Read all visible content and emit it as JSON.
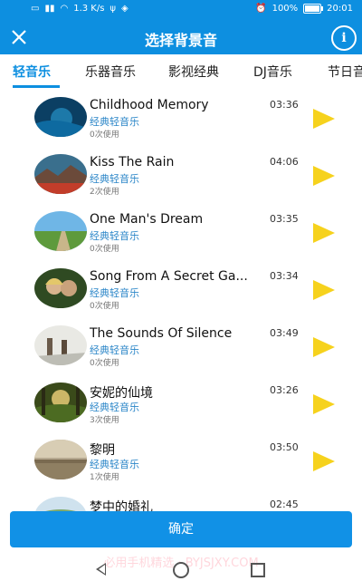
{
  "status_bar": {
    "left_signal_text": "1.3 K/s",
    "battery": "100%",
    "time": "20:01"
  },
  "header": {
    "title": "选择背景音"
  },
  "tabs": [
    {
      "label": "轻音乐",
      "active": true
    },
    {
      "label": "乐器音乐"
    },
    {
      "label": "影视经典"
    },
    {
      "label": "DJ音乐"
    },
    {
      "label": "节日音"
    }
  ],
  "songs": [
    {
      "title": "Childhood Memory",
      "category": "经典轻音乐",
      "uses": "0次使用",
      "duration": "03:36"
    },
    {
      "title": "Kiss The Rain",
      "category": "经典轻音乐",
      "uses": "2次使用",
      "duration": "04:06"
    },
    {
      "title": "One Man's Dream",
      "category": "经典轻音乐",
      "uses": "0次使用",
      "duration": "03:35"
    },
    {
      "title": "Song From A Secret Ga...",
      "category": "经典轻音乐",
      "uses": "0次使用",
      "duration": "03:34"
    },
    {
      "title": "The Sounds Of Silence",
      "category": "经典轻音乐",
      "uses": "0次使用",
      "duration": "03:49"
    },
    {
      "title": "安妮的仙境",
      "category": "经典轻音乐",
      "uses": "3次使用",
      "duration": "03:26"
    },
    {
      "title": "黎明",
      "category": "经典轻音乐",
      "uses": "1次使用",
      "duration": "03:50"
    },
    {
      "title": "梦中的婚礼",
      "category": "",
      "uses": "",
      "duration": "02:45"
    }
  ],
  "confirm_label": "确定",
  "watermark": "必用手机精选 · BYJSJXY.COM",
  "colors": {
    "primary": "#0d8fe0",
    "play_icon": "#f6d21d",
    "category_text": "#2b86c8"
  }
}
